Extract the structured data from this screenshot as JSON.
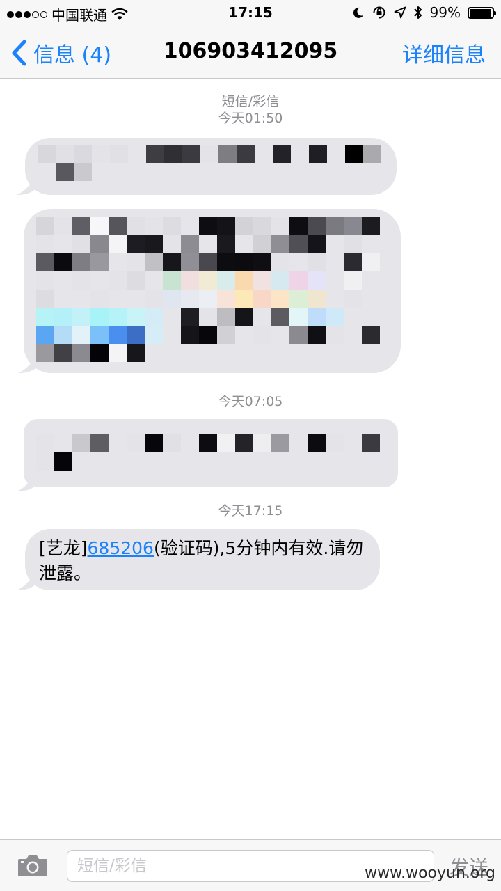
{
  "status_bar": {
    "carrier": "中国联通",
    "time": "17:15",
    "battery": "99%"
  },
  "nav": {
    "back_label": "信息 (4)",
    "title": "106903412095",
    "details_label": "详细信息"
  },
  "conversation": {
    "service_label": "短信/彩信",
    "timestamps": [
      "今天01:50",
      "今天07:05",
      "今天17:15"
    ],
    "last_message": {
      "prefix": "[艺龙]",
      "code": "685206",
      "suffix": "(验证码),5分钟内有效.请勿泄露。"
    }
  },
  "input": {
    "placeholder": "短信/彩信",
    "send_label": "发送"
  },
  "watermark": "www.wooyun.org",
  "colors": {
    "accent": "#1a82fb",
    "bubble": "#e5e5ea",
    "timestamp": "#8e8e93",
    "bar_bg": "#f7f7f7"
  }
}
